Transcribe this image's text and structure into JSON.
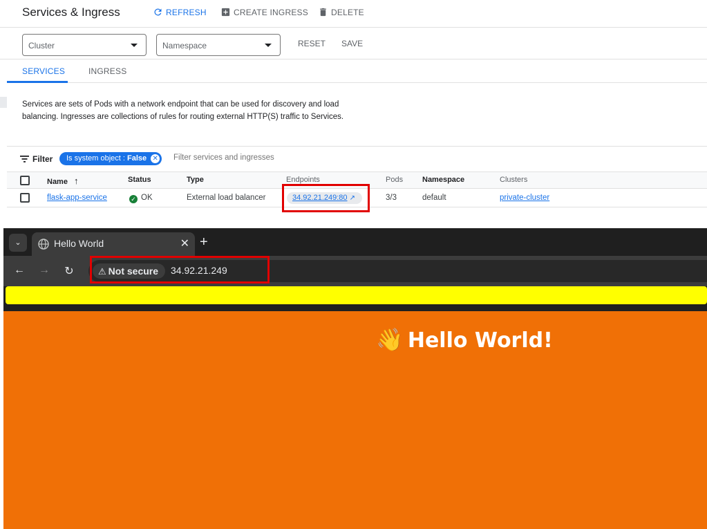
{
  "console": {
    "title": "Services & Ingress",
    "toolbar": {
      "refresh": "REFRESH",
      "create": "CREATE INGRESS",
      "delete": "DELETE"
    },
    "filters": {
      "cluster": "Cluster",
      "namespace": "Namespace",
      "reset": "RESET",
      "save": "SAVE"
    },
    "tabs": [
      {
        "label": "SERVICES",
        "active": true
      },
      {
        "label": "INGRESS",
        "active": false
      }
    ],
    "description": "Services are sets of Pods with a network endpoint that can be used for discovery and load balancing. Ingresses are collections of rules for routing external HTTP(S) traffic to Services.",
    "filter_bar": {
      "label": "Filter",
      "chip_prefix": "Is system object : ",
      "chip_value": "False",
      "placeholder": "Filter services and ingresses"
    },
    "table": {
      "columns": [
        "Name",
        "Status",
        "Type",
        "Endpoints",
        "Pods",
        "Namespace",
        "Clusters"
      ],
      "sort_icon": "arrow-up-icon",
      "rows": [
        {
          "name": "flask-app-service",
          "status": "OK",
          "type": "External load balancer",
          "endpoint": "34.92.21.249:80",
          "pods": "3/3",
          "namespace": "default",
          "cluster": "private-cluster"
        }
      ]
    },
    "colors": {
      "accent": "#1a73e8",
      "ok": "#188038",
      "highlight": "#e10000"
    }
  },
  "browser": {
    "tab_title": "Hello World",
    "security": "Not secure",
    "url": "34.92.21.249",
    "page": {
      "emoji": "👋",
      "heading": "Hello World!",
      "banner_color": "#ffff00",
      "background": "#f07006"
    }
  }
}
